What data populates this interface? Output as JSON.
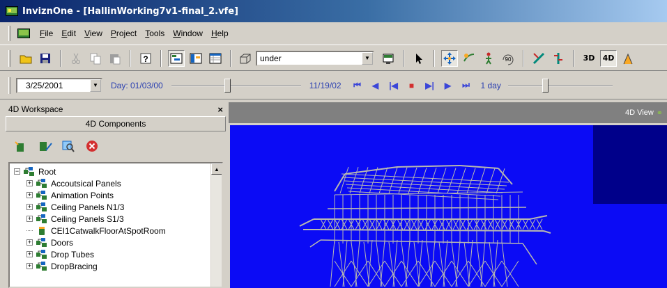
{
  "window": {
    "title": "InviznOne - [HallinWorking7v1-final_2.vfe]"
  },
  "menu": {
    "items": [
      {
        "label": "File",
        "key": "F",
        "rest": "ile"
      },
      {
        "label": "Edit",
        "key": "E",
        "rest": "dit"
      },
      {
        "label": "View",
        "key": "V",
        "rest": "iew"
      },
      {
        "label": "Project",
        "key": "P",
        "rest": "roject"
      },
      {
        "label": "Tools",
        "key": "T",
        "rest": "ools"
      },
      {
        "label": "Window",
        "key": "W",
        "rest": "indow"
      },
      {
        "label": "Help",
        "key": "H",
        "rest": "elp"
      }
    ]
  },
  "toolbar": {
    "view_combo_value": "under",
    "btn_3d_label": "3D",
    "btn_4d_label": "4D"
  },
  "timeline": {
    "current_date": "3/25/2001",
    "day_label": "Day:  01/03/00",
    "end_date": "11/19/02",
    "step_label": "1 day",
    "date_slider_position": 0.43,
    "step_slider_position": 0.35,
    "vcr": [
      "⏮",
      "◀",
      "|◀",
      "■",
      "▶|",
      "▶",
      "⏭"
    ]
  },
  "workspace": {
    "title": "4D Workspace",
    "close": "×",
    "tab": "4D Components",
    "tree": [
      {
        "label": "Root",
        "level": 0,
        "expander": "−",
        "icon": "group-icon"
      },
      {
        "label": "Accoutsical Panels",
        "level": 1,
        "expander": "+",
        "icon": "group-icon"
      },
      {
        "label": "Animation Points",
        "level": 1,
        "expander": "+",
        "icon": "group-icon"
      },
      {
        "label": "Ceiling Panels N1/3",
        "level": 1,
        "expander": "+",
        "icon": "group-icon"
      },
      {
        "label": "Ceiling Panels S1/3",
        "level": 1,
        "expander": "+",
        "icon": "group-icon"
      },
      {
        "label": "CEI1CatwalkFloorAtSpotRoom",
        "level": 1,
        "expander": "",
        "icon": "component-icon"
      },
      {
        "label": "Doors",
        "level": 1,
        "expander": "+",
        "icon": "group-icon"
      },
      {
        "label": "Drop Tubes",
        "level": 1,
        "expander": "+",
        "icon": "group-icon"
      },
      {
        "label": "DropBracing",
        "level": 1,
        "expander": "+",
        "icon": "group-icon"
      }
    ]
  },
  "view": {
    "title": "4D View"
  },
  "colors": {
    "canvas_bg": "#0b0bf5",
    "inset_bg": "#00008a",
    "title_bar_start": "#0a246a",
    "timeline_text": "#2a3fb0"
  }
}
